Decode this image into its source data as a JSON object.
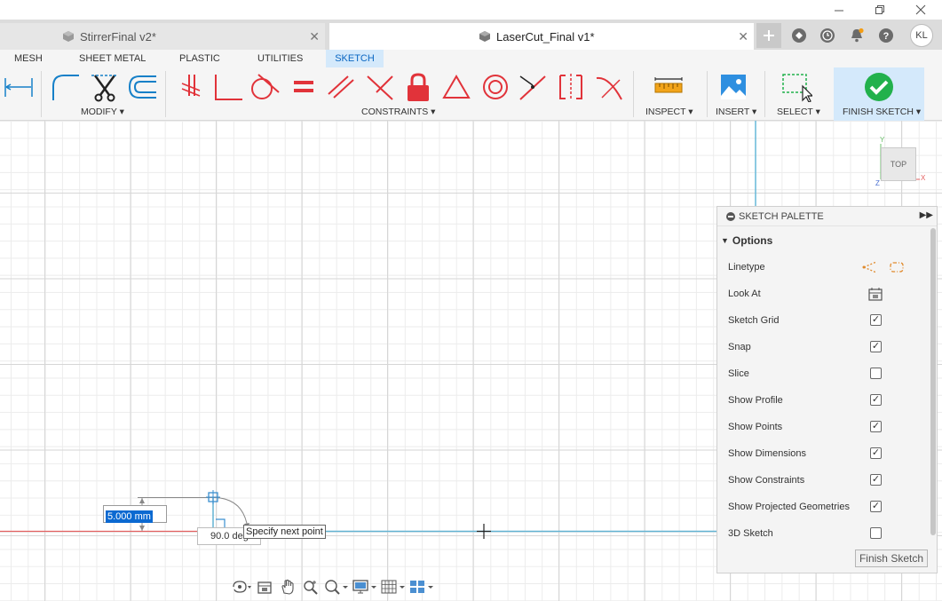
{
  "window": {
    "controls": [
      "minimize",
      "restore",
      "close"
    ]
  },
  "tabs": [
    {
      "label": "StirrerFinal v2*",
      "active": false
    },
    {
      "label": "LaserCut_Final v1*",
      "active": true
    }
  ],
  "user": {
    "initials": "KL"
  },
  "ribbon": {
    "tabs": [
      {
        "label": "MESH",
        "active": false
      },
      {
        "label": "SHEET METAL",
        "active": false
      },
      {
        "label": "PLASTIC",
        "active": false
      },
      {
        "label": "UTILITIES",
        "active": false
      },
      {
        "label": "SKETCH",
        "active": true
      }
    ],
    "groups": {
      "modify": "MODIFY",
      "constraints": "CONSTRAINTS",
      "inspect": "INSPECT",
      "insert": "INSERT",
      "select": "SELECT",
      "finish_sketch": "FINISH SKETCH"
    },
    "tools": [
      "dimension",
      "fillet",
      "trim",
      "offset",
      "coincident",
      "perpendicular-line",
      "tangent",
      "equal",
      "parallel",
      "perpendicular",
      "fix-lock",
      "triangle",
      "concentric",
      "midpoint",
      "symmetry",
      "curvature"
    ],
    "colors": {
      "active_tab_bg": "#d4e9fb",
      "active_tab_text": "#0a66c2",
      "tool_red": "#e1333a",
      "tool_blue": "#1680c8",
      "finish_green": "#22b14c"
    }
  },
  "viewcube": {
    "face": "TOP",
    "axes": {
      "x": "X",
      "y": "Y",
      "z": "Z"
    }
  },
  "palette": {
    "title": "SKETCH PALETTE",
    "section": "Options",
    "rows": [
      {
        "label": "Linetype",
        "type": "icons"
      },
      {
        "label": "Look At",
        "type": "icon"
      },
      {
        "label": "Sketch Grid",
        "type": "checkbox",
        "checked": true
      },
      {
        "label": "Snap",
        "type": "checkbox",
        "checked": true
      },
      {
        "label": "Slice",
        "type": "checkbox",
        "checked": false
      },
      {
        "label": "Show Profile",
        "type": "checkbox",
        "checked": true
      },
      {
        "label": "Show Points",
        "type": "checkbox",
        "checked": true
      },
      {
        "label": "Show Dimensions",
        "type": "checkbox",
        "checked": true
      },
      {
        "label": "Show Constraints",
        "type": "checkbox",
        "checked": true
      },
      {
        "label": "Show Projected Geometries",
        "type": "checkbox",
        "checked": true
      },
      {
        "label": "3D Sketch",
        "type": "checkbox",
        "checked": false
      }
    ],
    "finish_button": "Finish Sketch"
  },
  "sketch": {
    "dimension_value": "5.000 mm",
    "angle_value": "90.0 deg",
    "tooltip": "Specify next point"
  },
  "navbar": {
    "tools": [
      "orbit",
      "look-at",
      "pan",
      "zoom",
      "fit",
      "display-settings",
      "grid-settings",
      "viewports"
    ]
  }
}
